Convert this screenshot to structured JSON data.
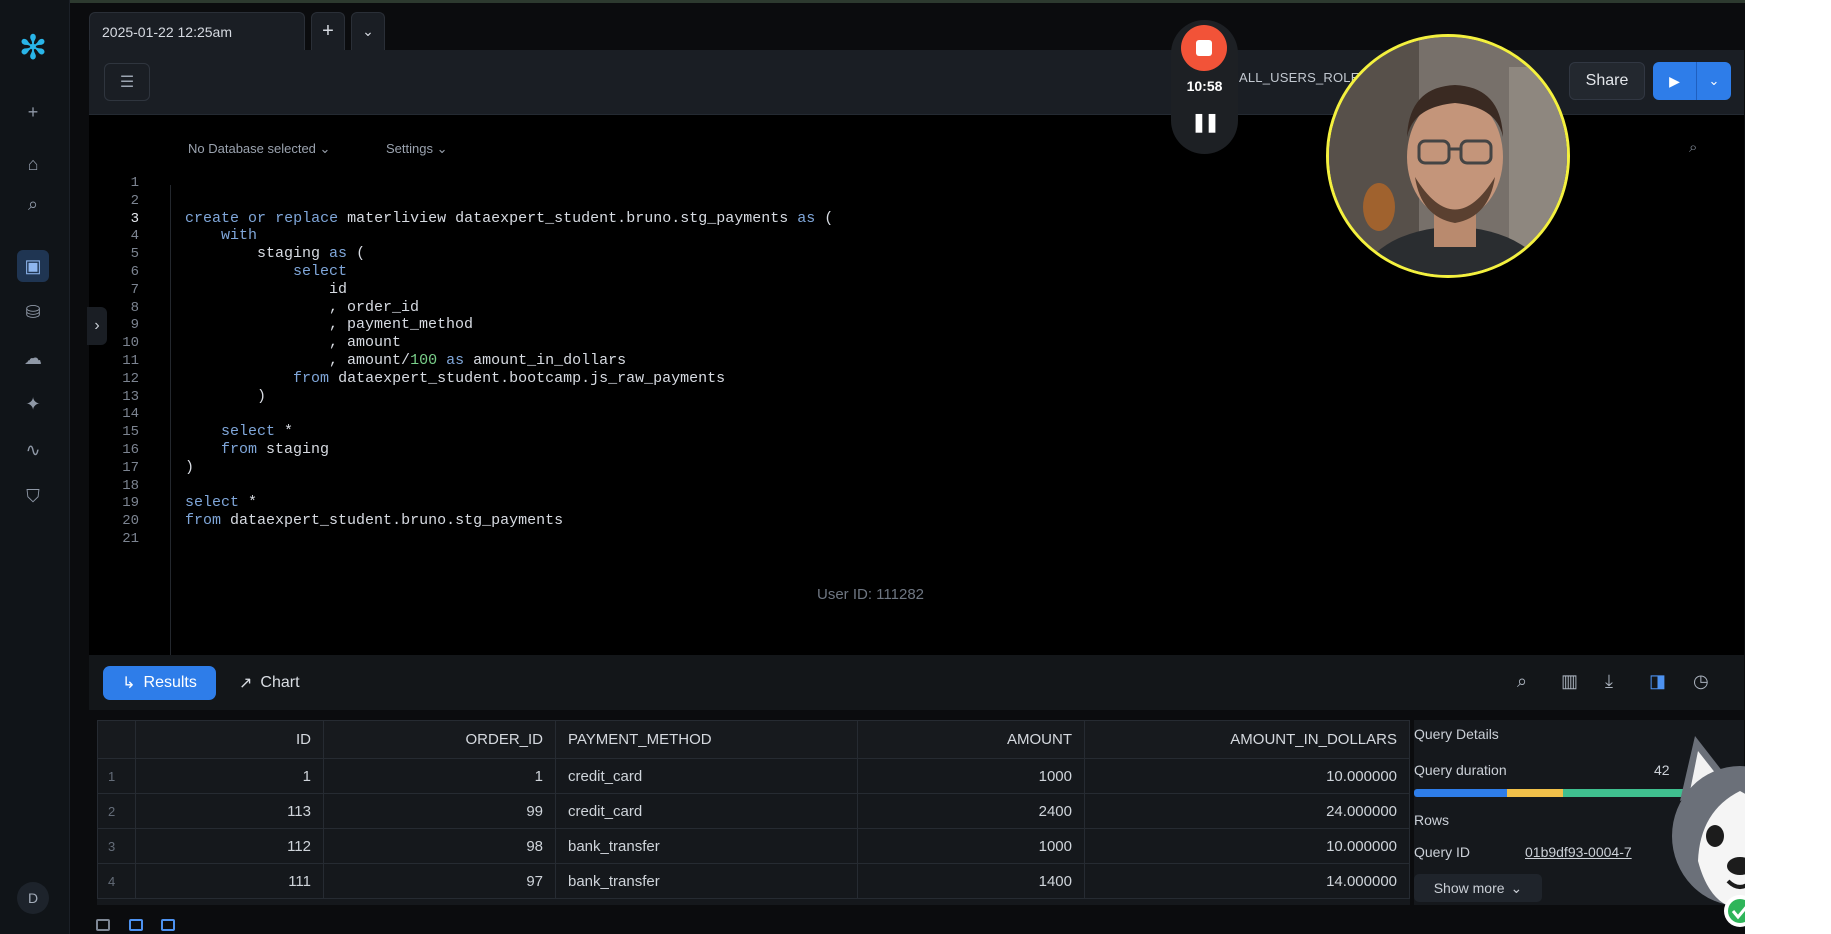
{
  "tabs": {
    "file_tab": "2025-01-22 12:25am",
    "add_label": "+",
    "dropdown_label": "⌄"
  },
  "toolbar": {
    "role": "ALL_USERS_ROLE",
    "share_label": "Share"
  },
  "editor_context": {
    "database": "No Database selected",
    "settings": "Settings"
  },
  "code_lines": [
    {
      "n": "1",
      "text": ""
    },
    {
      "n": "2",
      "text": ""
    },
    {
      "n": "3",
      "text": "create or replace materliview dataexpert_student.bruno.stg_payments as ("
    },
    {
      "n": "4",
      "text": "    with"
    },
    {
      "n": "5",
      "text": "        staging as ("
    },
    {
      "n": "6",
      "text": "            select"
    },
    {
      "n": "7",
      "text": "                id"
    },
    {
      "n": "8",
      "text": "                , order_id"
    },
    {
      "n": "9",
      "text": "                , payment_method"
    },
    {
      "n": "10",
      "text": "                , amount"
    },
    {
      "n": "11",
      "text": "                , amount/100 as amount_in_dollars"
    },
    {
      "n": "12",
      "text": "            from dataexpert_student.bootcamp.js_raw_payments"
    },
    {
      "n": "13",
      "text": "        )"
    },
    {
      "n": "14",
      "text": ""
    },
    {
      "n": "15",
      "text": "    select *"
    },
    {
      "n": "16",
      "text": "    from staging"
    },
    {
      "n": "17",
      "text": ")"
    },
    {
      "n": "18",
      "text": ""
    },
    {
      "n": "19",
      "text": "select *"
    },
    {
      "n": "20",
      "text": "from dataexpert_student.bruno.stg_payments"
    },
    {
      "n": "21",
      "text": ""
    }
  ],
  "watermark": "User ID: 111282",
  "results": {
    "results_label": "Results",
    "chart_label": "Chart",
    "columns": [
      "ID",
      "ORDER_ID",
      "PAYMENT_METHOD",
      "AMOUNT",
      "AMOUNT_IN_DOLLARS"
    ],
    "rows": [
      {
        "rn": "1",
        "cells": [
          "1",
          "1",
          "credit_card",
          "1000",
          "10.000000"
        ]
      },
      {
        "rn": "2",
        "cells": [
          "113",
          "99",
          "credit_card",
          "2400",
          "24.000000"
        ]
      },
      {
        "rn": "3",
        "cells": [
          "112",
          "98",
          "bank_transfer",
          "1000",
          "10.000000"
        ]
      },
      {
        "rn": "4",
        "cells": [
          "111",
          "97",
          "bank_transfer",
          "1400",
          "14.000000"
        ]
      }
    ]
  },
  "query_details": {
    "title": "Query Details",
    "duration_label": "Query duration",
    "duration_value": "42",
    "rows_label": "Rows",
    "query_id_label": "Query ID",
    "query_id_value": "01b9df93-0004-7",
    "show_more": "Show more",
    "duration_bar_colors": [
      "#2e7de9",
      "#f0c04a",
      "#3fbf8f"
    ]
  },
  "recorder": {
    "time": "10:58"
  },
  "user_initial": "D",
  "colors": {
    "accent": "#2e7de9",
    "record": "#f25338",
    "webcam_ring": "#f4f13e"
  }
}
